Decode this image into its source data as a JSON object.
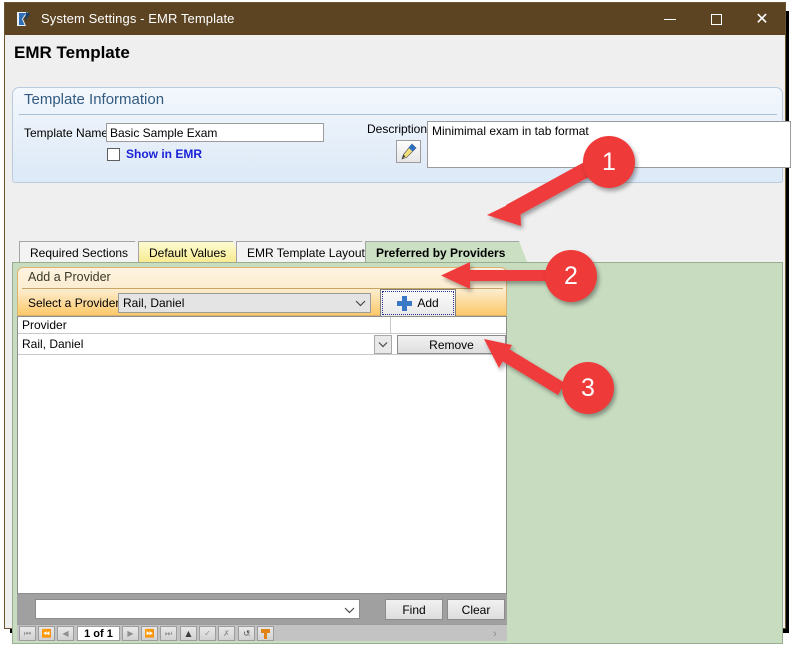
{
  "window": {
    "title": "System Settings - EMR Template",
    "app_icon": "app-icon",
    "minimize": "—",
    "maximize": "□",
    "close": "✕"
  },
  "page": {
    "title": "EMR Template"
  },
  "template_information": {
    "caption": "Template Information",
    "template_name_label": "Template Name",
    "template_name_value": "Basic Sample Exam",
    "show_in_emr_label": "Show in EMR",
    "show_in_emr_checked": false,
    "description_label": "Description",
    "description_value": "Minimimal exam in tab format",
    "edit_icon": "pencil-icon"
  },
  "tabs": [
    {
      "label": "Required Sections",
      "state": "normal"
    },
    {
      "label": "Default Values",
      "state": "highlighted-yellow"
    },
    {
      "label": "EMR Template Layout",
      "state": "normal"
    },
    {
      "label": "Preferred by Providers",
      "state": "active"
    }
  ],
  "add_provider": {
    "caption": "Add a Provider",
    "select_label": "Select a Provider",
    "selected_provider": "Rail, Daniel",
    "dropdown_icon": "chevron-down-icon",
    "add_button_label": "Add",
    "add_button_icon": "plus-icon"
  },
  "provider_grid": {
    "column_header": "Provider",
    "rows": [
      {
        "provider": "Rail, Daniel",
        "row_dropdown_icon": "chevron-down-icon",
        "action_label": "Remove"
      }
    ]
  },
  "find_bar": {
    "search_value": "",
    "search_dropdown_icon": "chevron-down-icon",
    "find_label": "Find",
    "clear_label": "Clear"
  },
  "navigator": {
    "buttons": [
      {
        "name": "first-record",
        "glyph": "⏮",
        "enabled": false
      },
      {
        "name": "prior-page",
        "glyph": "⏪",
        "enabled": false
      },
      {
        "name": "prior-record",
        "glyph": "◀",
        "enabled": false
      },
      {
        "name": "next-record",
        "glyph": "▶",
        "enabled": false
      },
      {
        "name": "next-page",
        "glyph": "⏩",
        "enabled": false
      },
      {
        "name": "last-record",
        "glyph": "⏭",
        "enabled": false
      },
      {
        "name": "insert-record",
        "glyph": "▲",
        "enabled": true
      },
      {
        "name": "post-edit",
        "glyph": "✓",
        "enabled": false
      },
      {
        "name": "cancel-edit",
        "glyph": "✗",
        "enabled": false
      },
      {
        "name": "refresh-records",
        "glyph": "↺",
        "enabled": true
      }
    ],
    "page_indicator": "1 of 1",
    "filter_icon": "funnel-icon",
    "scroll_left_glyph": "‹",
    "scroll_right_glyph": "›"
  },
  "callouts": [
    {
      "number": "1",
      "target": "preferred-by-providers-tab"
    },
    {
      "number": "2",
      "target": "add-button"
    },
    {
      "number": "3",
      "target": "remove-button"
    }
  ],
  "colors": {
    "titlebar": "#5c4423",
    "tab_active": "#cbdfc3",
    "tab_highlight": "#f7ea8e",
    "panel_orange": "#fcc969",
    "callout_red": "#ef3a3a",
    "link_blue": "#1a23d6"
  }
}
